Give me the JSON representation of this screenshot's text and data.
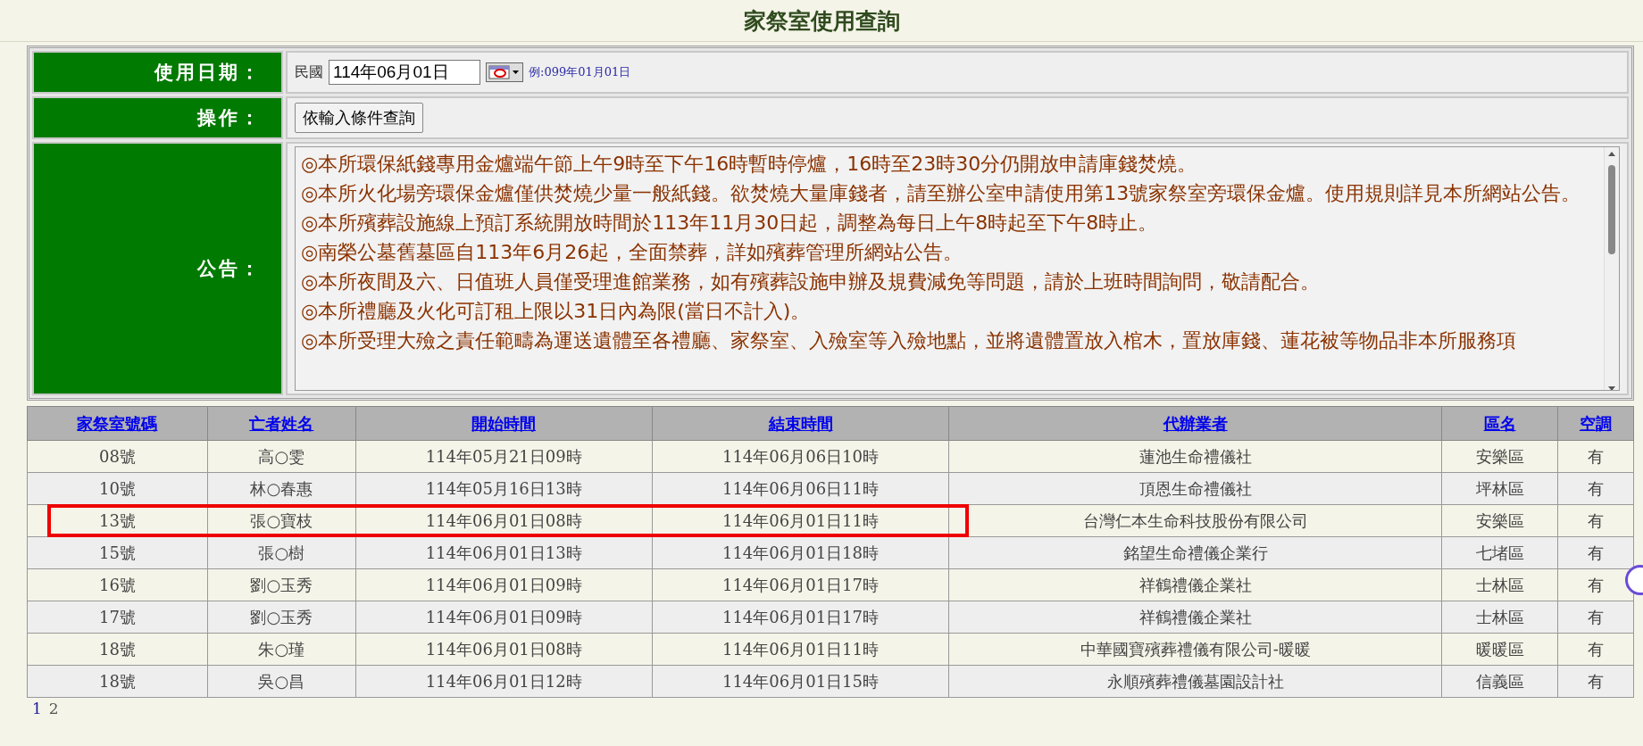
{
  "title": "家祭室使用查詢",
  "form": {
    "date_label": "使用日期：",
    "era": "民國",
    "date_value": "114年06月01日",
    "date_hint": "例:099年01月01日",
    "action_label": "操作：",
    "action_button": "依輸入條件查詢",
    "notice_label": "公告：",
    "notices": [
      "◎本所環保紙錢專用金爐端午節上午9時至下午16時暫時停爐，16時至23時30分仍開放申請庫錢焚燒。",
      "◎本所火化場旁環保金爐僅供焚燒少量一般紙錢。欲焚燒大量庫錢者，請至辦公室申請使用第13號家祭室旁環保金爐。使用規則詳見本所網站公告。",
      "◎本所殯葬設施線上預訂系統開放時間於113年11月30日起，調整為每日上午8時起至下午8時止。",
      "◎南榮公墓舊墓區自113年6月26起，全面禁葬，詳如殯葬管理所網站公告。",
      "◎本所夜間及六、日值班人員僅受理進館業務，如有殯葬設施申辦及規費減免等問題，請於上班時間詢問，敬請配合。",
      "◎本所禮廳及火化可訂租上限以31日內為限(當日不計入)。",
      "◎本所受理大殮之責任範疇為運送遺體至各禮廳、家祭室、入殮室等入殮地點，並將遺體置放入棺木，置放庫錢、蓮花被等物品非本所服務項"
    ]
  },
  "table": {
    "columns": [
      "家祭室號碼",
      "亡者姓名",
      "開始時間",
      "結束時間",
      "代辦業者",
      "區名",
      "空調"
    ],
    "rows": [
      {
        "cells": [
          "08號",
          "高○雯",
          "114年05月21日09時",
          "114年06月06日10時",
          "蓮池生命禮儀社",
          "安樂區",
          "有"
        ],
        "highlighted": false
      },
      {
        "cells": [
          "10號",
          "林○春惠",
          "114年05月16日13時",
          "114年06月06日11時",
          "頂恩生命禮儀社",
          "坪林區",
          "有"
        ],
        "highlighted": false
      },
      {
        "cells": [
          "13號",
          "張○寶枝",
          "114年06月01日08時",
          "114年06月01日11時",
          "台灣仁本生命科技股份有限公司",
          "安樂區",
          "有"
        ],
        "highlighted": true
      },
      {
        "cells": [
          "15號",
          "張○樹",
          "114年06月01日13時",
          "114年06月01日18時",
          "銘望生命禮儀企業行",
          "七堵區",
          "有"
        ],
        "highlighted": false
      },
      {
        "cells": [
          "16號",
          "劉○玉秀",
          "114年06月01日09時",
          "114年06月01日17時",
          "祥鶴禮儀企業社",
          "士林區",
          "有"
        ],
        "highlighted": false
      },
      {
        "cells": [
          "17號",
          "劉○玉秀",
          "114年06月01日09時",
          "114年06月01日17時",
          "祥鶴禮儀企業社",
          "士林區",
          "有"
        ],
        "highlighted": false
      },
      {
        "cells": [
          "18號",
          "朱○瑾",
          "114年06月01日08時",
          "114年06月01日11時",
          "中華國寶殯葬禮儀有限公司-暖暖",
          "暖暖區",
          "有"
        ],
        "highlighted": false
      },
      {
        "cells": [
          "18號",
          "吳○昌",
          "114年06月01日12時",
          "114年06月01日15時",
          "永順殯葬禮儀墓園設計社",
          "信義區",
          "有"
        ],
        "highlighted": false
      }
    ]
  },
  "pages": [
    {
      "label": "1",
      "selected": true
    },
    {
      "label": "2",
      "selected": false
    }
  ]
}
